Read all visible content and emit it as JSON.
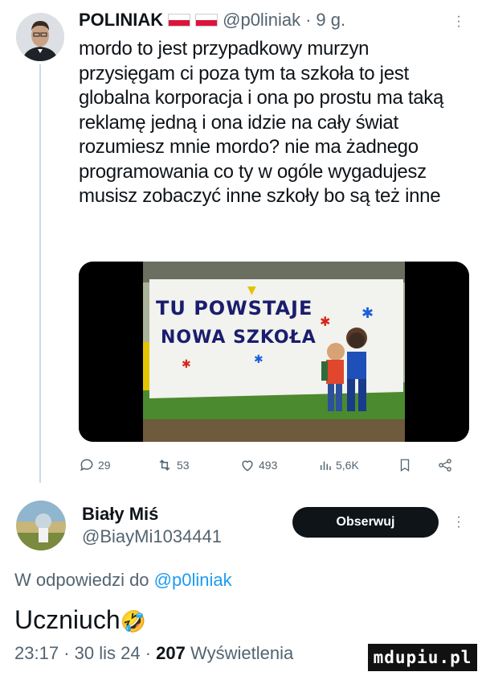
{
  "tweet": {
    "author_name": "POLINIAK",
    "author_handle": "@p0liniak",
    "time": "9 g.",
    "text": "mordo to jest przypadkowy murzyn przysięgam ci poza tym ta szkoła to jest globalna korporacja i ona po prostu ma taką reklamę jedną i ona idzie na cały świat rozumiesz mnie mordo? nie ma żadnego programowania co ty w ogóle wygadujesz musisz zobaczyć inne szkoły bo są też inne",
    "media": {
      "banner_line1": "TU POWSTAJE",
      "banner_line2": "NOWA SZKOŁA"
    },
    "actions": {
      "replies": "29",
      "retweets": "53",
      "likes": "493",
      "views": "5,6K"
    }
  },
  "reply": {
    "author_name": "Biały Miś",
    "author_handle": "@BiayMi1034441",
    "follow_label": "Obserwuj",
    "reply_prefix": "W odpowiedzi do",
    "reply_to_handle": "@p0liniak",
    "text": "Uczniuch",
    "emoji": "🤣",
    "time": "23:17",
    "date": "30 lis 24",
    "views_count": "207",
    "views_label": "Wyświetlenia"
  },
  "watermark": "mdupiu.pl",
  "colors": {
    "link": "#1d9bf0",
    "muted": "#536471",
    "button": "#0f1419"
  },
  "icons": [
    "reply-icon",
    "retweet-icon",
    "like-icon",
    "views-icon",
    "bookmark-icon",
    "share-icon",
    "more-icon",
    "flag-icon"
  ]
}
